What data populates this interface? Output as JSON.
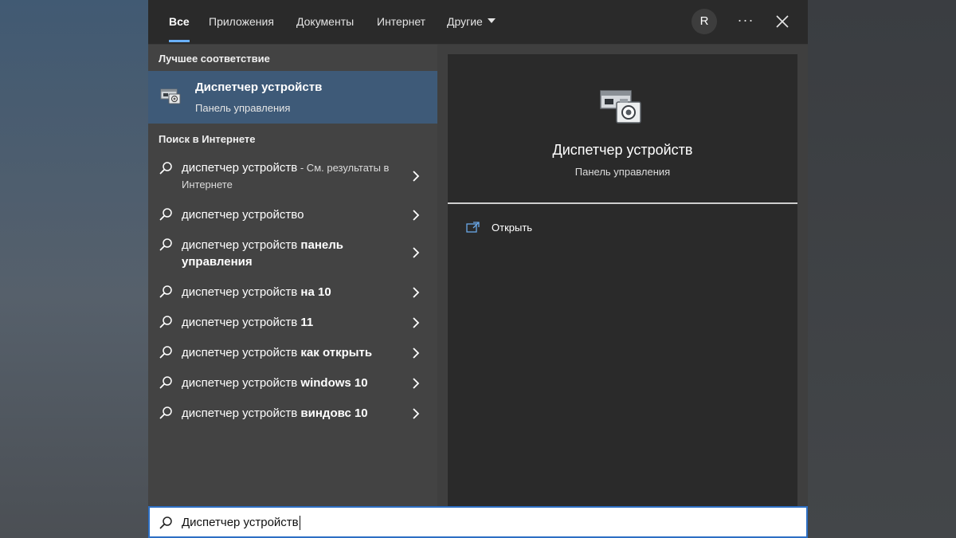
{
  "tabs": [
    {
      "label": "Все",
      "active": true
    },
    {
      "label": "Приложения"
    },
    {
      "label": "Документы"
    },
    {
      "label": "Интернет"
    },
    {
      "label": "Другие"
    }
  ],
  "account": {
    "initial": "R"
  },
  "toolbar": {
    "more_label": "···"
  },
  "best_match": {
    "heading": "Лучшее соответствие",
    "title": "Диспетчер устройств",
    "subtitle": "Панель управления",
    "icon": "device-manager-icon"
  },
  "web_search": {
    "heading": "Поиск в Интернете",
    "items": [
      {
        "base": "диспетчер устройств",
        "bold": "",
        "hint": " - См. результаты в Интернете"
      },
      {
        "base": "диспетчер устройство",
        "bold": "",
        "hint": ""
      },
      {
        "base": "диспетчер устройств",
        "bold": " панель управления",
        "hint": ""
      },
      {
        "base": "диспетчер устройств",
        "bold": " на 10",
        "hint": ""
      },
      {
        "base": "диспетчер устройств",
        "bold": " 11",
        "hint": ""
      },
      {
        "base": "диспетчер устройств",
        "bold": " как открыть",
        "hint": ""
      },
      {
        "base": "диспетчер устройств",
        "bold": " windows 10",
        "hint": ""
      },
      {
        "base": "диспетчер устройств",
        "bold": " виндовс 10",
        "hint": ""
      }
    ]
  },
  "preview": {
    "title": "Диспетчер устройств",
    "subtitle": "Панель управления",
    "actions": [
      {
        "label": "Открыть",
        "icon": "open-external-icon"
      }
    ]
  },
  "search": {
    "value": "Диспетчер устройств"
  },
  "colors": {
    "accent": "#69b0ff",
    "selected": "#3e5a78",
    "focus_border": "#2d6fc4"
  }
}
